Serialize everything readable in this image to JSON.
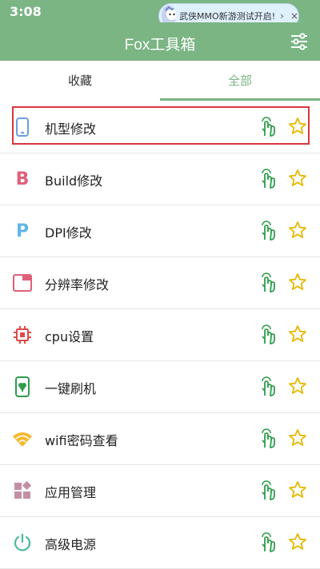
{
  "status": {
    "time": "3:08"
  },
  "notification": {
    "text": "武侠MMO新游测试开启!",
    "chevron": "›",
    "close": "×"
  },
  "appbar": {
    "title": "Fox工具箱"
  },
  "tabs": [
    {
      "label": "收藏",
      "active": false
    },
    {
      "label": "全部",
      "active": true
    }
  ],
  "colors": {
    "accent": "#7ab583",
    "highlight": "#d9363e"
  },
  "items": [
    {
      "label": "机型修改",
      "icon": "phone-icon",
      "selected": true
    },
    {
      "label": "Build修改",
      "icon": "b-letter-icon"
    },
    {
      "label": "DPI修改",
      "icon": "p-letter-icon"
    },
    {
      "label": "分辨率修改",
      "icon": "screen-icon"
    },
    {
      "label": "cpu设置",
      "icon": "cpu-chip-icon"
    },
    {
      "label": "一键刷机",
      "icon": "flash-phone-icon"
    },
    {
      "label": "wifi密码查看",
      "icon": "wifi-icon"
    },
    {
      "label": "应用管理",
      "icon": "apps-grid-icon"
    },
    {
      "label": "高级电源",
      "icon": "power-icon"
    }
  ]
}
